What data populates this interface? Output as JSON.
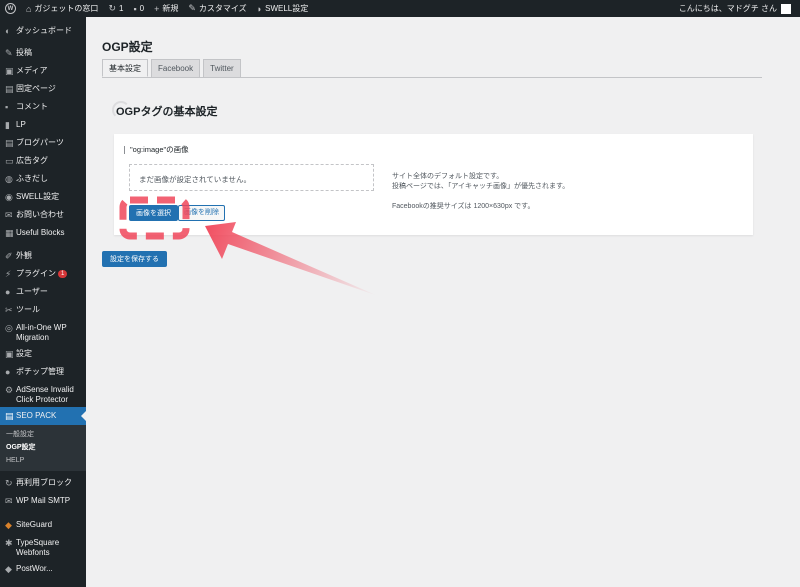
{
  "adminbar": {
    "site_name": "ガジェットの窓口",
    "updates_count": "1",
    "comments_count": "0",
    "new_label": "新規",
    "customize_label": "カスタマイズ",
    "swell_label": "SWELL設定",
    "greeting": "こんにちは、マドグチ さん"
  },
  "sidebar": {
    "items": [
      {
        "icon": "dashboard-icon",
        "glyph": "◐",
        "label": "ダッシュボード"
      },
      {
        "icon": "pin-icon",
        "glyph": "✎",
        "label": "投稿"
      },
      {
        "icon": "media-icon",
        "glyph": "▣",
        "label": "メディア"
      },
      {
        "icon": "page-icon",
        "glyph": "▤",
        "label": "固定ページ"
      },
      {
        "icon": "comment-icon",
        "glyph": "▪",
        "label": "コメント"
      },
      {
        "icon": "lp-icon",
        "glyph": "▮",
        "label": "LP"
      },
      {
        "icon": "blog-parts-icon",
        "glyph": "▤",
        "label": "ブログパーツ"
      },
      {
        "icon": "ad-tag-icon",
        "glyph": "▭",
        "label": "広告タグ"
      },
      {
        "icon": "balloon-icon",
        "glyph": "◍",
        "label": "ふきだし"
      },
      {
        "icon": "swell-settings-icon",
        "glyph": "◉",
        "label": "SWELL設定"
      },
      {
        "icon": "contact-icon",
        "glyph": "✉",
        "label": "お問い合わせ"
      },
      {
        "icon": "blocks-icon",
        "glyph": "▦",
        "label": "Useful Blocks"
      },
      {
        "icon": "appearance-icon",
        "glyph": "✐",
        "label": "外観"
      },
      {
        "icon": "plugin-icon",
        "glyph": "⚡",
        "label": "プラグイン",
        "badge": "1"
      },
      {
        "icon": "users-icon",
        "glyph": "●",
        "label": "ユーザー"
      },
      {
        "icon": "tools-icon",
        "glyph": "✂",
        "label": "ツール"
      },
      {
        "icon": "migration-icon",
        "glyph": "◎",
        "label": "All-in-One WP Migration"
      },
      {
        "icon": "settings-icon",
        "glyph": "▣",
        "label": "設定"
      },
      {
        "icon": "pochipp-icon",
        "glyph": "●",
        "label": "ポチップ管理"
      },
      {
        "icon": "adsense-icon",
        "glyph": "⚙",
        "label": "AdSense Invalid Click Protector"
      },
      {
        "icon": "seo-pack-icon",
        "glyph": "▤",
        "label": "SEO PACK"
      },
      {
        "icon": "reusable-block-icon",
        "glyph": "↻",
        "label": "再利用ブロック"
      },
      {
        "icon": "mail-icon",
        "glyph": "✉",
        "label": "WP Mail SMTP"
      },
      {
        "icon": "siteguard-icon",
        "glyph": "◆",
        "label": "SiteGuard"
      },
      {
        "icon": "typesquare-icon",
        "glyph": "✱",
        "label": "TypeSquare Webfonts"
      },
      {
        "icon": "postman-icon",
        "glyph": "◆",
        "label": "PostWor..."
      }
    ],
    "submenu": [
      "一般設定",
      "OGP設定",
      "HELP"
    ]
  },
  "page": {
    "title": "OGP設定",
    "tabs": [
      "基本設定",
      "Facebook",
      "Twitter"
    ],
    "section_title": "OGPタグの基本設定",
    "field_label": "\"og:image\"の画像",
    "image_empty": "まだ画像が設定されていません。",
    "select_button": "画像を選択",
    "delete_button": "画像を削除",
    "desc_line1": "サイト全体のデフォルト設定です。",
    "desc_line2": "投稿ページでは、「アイキャッチ画像」が優先されます。",
    "desc_line3": "Facebookの推奨サイズは 1200×630px です。",
    "save_button": "設定を保存する"
  },
  "colors": {
    "admin_dark": "#1d2327",
    "accent_blue": "#2271b1",
    "annotation_red": "#f0475a"
  }
}
